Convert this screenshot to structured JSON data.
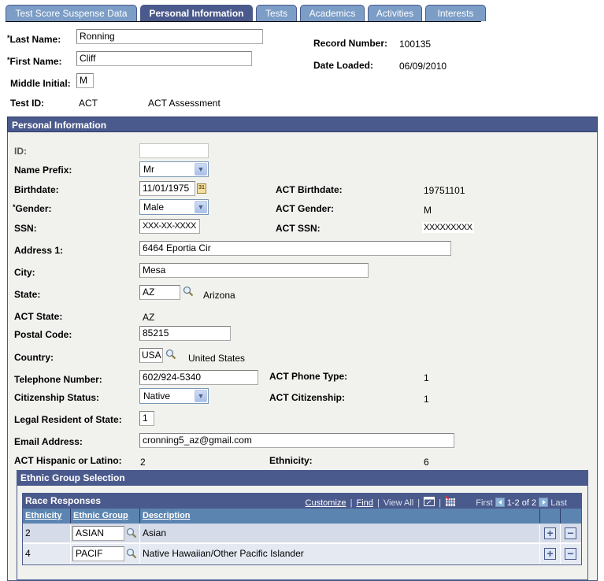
{
  "tabs": [
    {
      "label": "Test Score Suspense Data",
      "active": false
    },
    {
      "label": "Personal Information",
      "active": true
    },
    {
      "label": "Tests",
      "active": false
    },
    {
      "label": "Academics",
      "active": false
    },
    {
      "label": "Activities",
      "active": false
    },
    {
      "label": "Interests",
      "active": false
    }
  ],
  "header": {
    "last_name_label": "Last Name:",
    "last_name_value": "Ronning",
    "first_name_label": "First Name:",
    "first_name_value": "Cliff",
    "middle_initial_label": "Middle Initial:",
    "middle_initial_value": "M",
    "test_id_label": "Test ID:",
    "test_id_value": "ACT",
    "test_id_desc": "ACT Assessment",
    "record_number_label": "Record Number:",
    "record_number_value": "100135",
    "date_loaded_label": "Date Loaded:",
    "date_loaded_value": "06/09/2010",
    "required_marker": "*"
  },
  "personal": {
    "section_title": "Personal Information",
    "id_label": "ID:",
    "id_value": "",
    "name_prefix_label": "Name Prefix:",
    "name_prefix_value": "Mr",
    "birthdate_label": "Birthdate:",
    "birthdate_value": "11/01/1975",
    "calendar_icon_text": "31",
    "act_birthdate_label": "ACT Birthdate:",
    "act_birthdate_value": "19751101",
    "gender_label": "Gender:",
    "gender_value": "Male",
    "act_gender_label": "ACT Gender:",
    "act_gender_value": "M",
    "ssn_label": "SSN:",
    "ssn_value": "XXX-XX-XXXX",
    "act_ssn_label": "ACT SSN:",
    "act_ssn_value": "XXXXXXXXX",
    "address1_label": "Address 1:",
    "address1_value": "6464 Eportia Cir",
    "city_label": "City:",
    "city_value": "Mesa",
    "state_label": "State:",
    "state_value": "AZ",
    "state_desc": "Arizona",
    "act_state_label": "ACT State:",
    "act_state_value": "AZ",
    "postal_label": "Postal Code:",
    "postal_value": "85215",
    "country_label": "Country:",
    "country_value": "USA",
    "country_desc": "United States",
    "phone_label": "Telephone Number:",
    "phone_value": "602/924-5340",
    "act_phone_type_label": "ACT Phone Type:",
    "act_phone_type_value": "1",
    "citizenship_label": "Citizenship Status:",
    "citizenship_value": "Native",
    "act_citizenship_label": "ACT Citizenship:",
    "act_citizenship_value": "1",
    "legal_resident_label": "Legal Resident of State:",
    "legal_resident_value": "1",
    "email_label": "Email Address:",
    "email_value": "cronning5_az@gmail.com",
    "act_hispanic_label": "ACT Hispanic or Latino:",
    "act_hispanic_value": "2",
    "ethnicity_label": "Ethnicity:",
    "ethnicity_value": "6"
  },
  "ethnic": {
    "section_title": "Ethnic Group Selection",
    "grid_title": "Race Responses",
    "nav": {
      "customize": "Customize",
      "find": "Find",
      "view_all": "View All",
      "first": "First",
      "range": "1-2 of 2",
      "last": "Last",
      "sep": "|"
    },
    "columns": [
      "Ethnicity",
      "Ethnic Group",
      "Description"
    ],
    "rows": [
      {
        "ethnicity": "2",
        "group": "ASIAN",
        "description": "Asian"
      },
      {
        "ethnicity": "4",
        "group": "PACIF",
        "description": "Native Hawaiian/Other Pacific Islander"
      }
    ],
    "add_symbol": "+",
    "remove_symbol": "−"
  }
}
